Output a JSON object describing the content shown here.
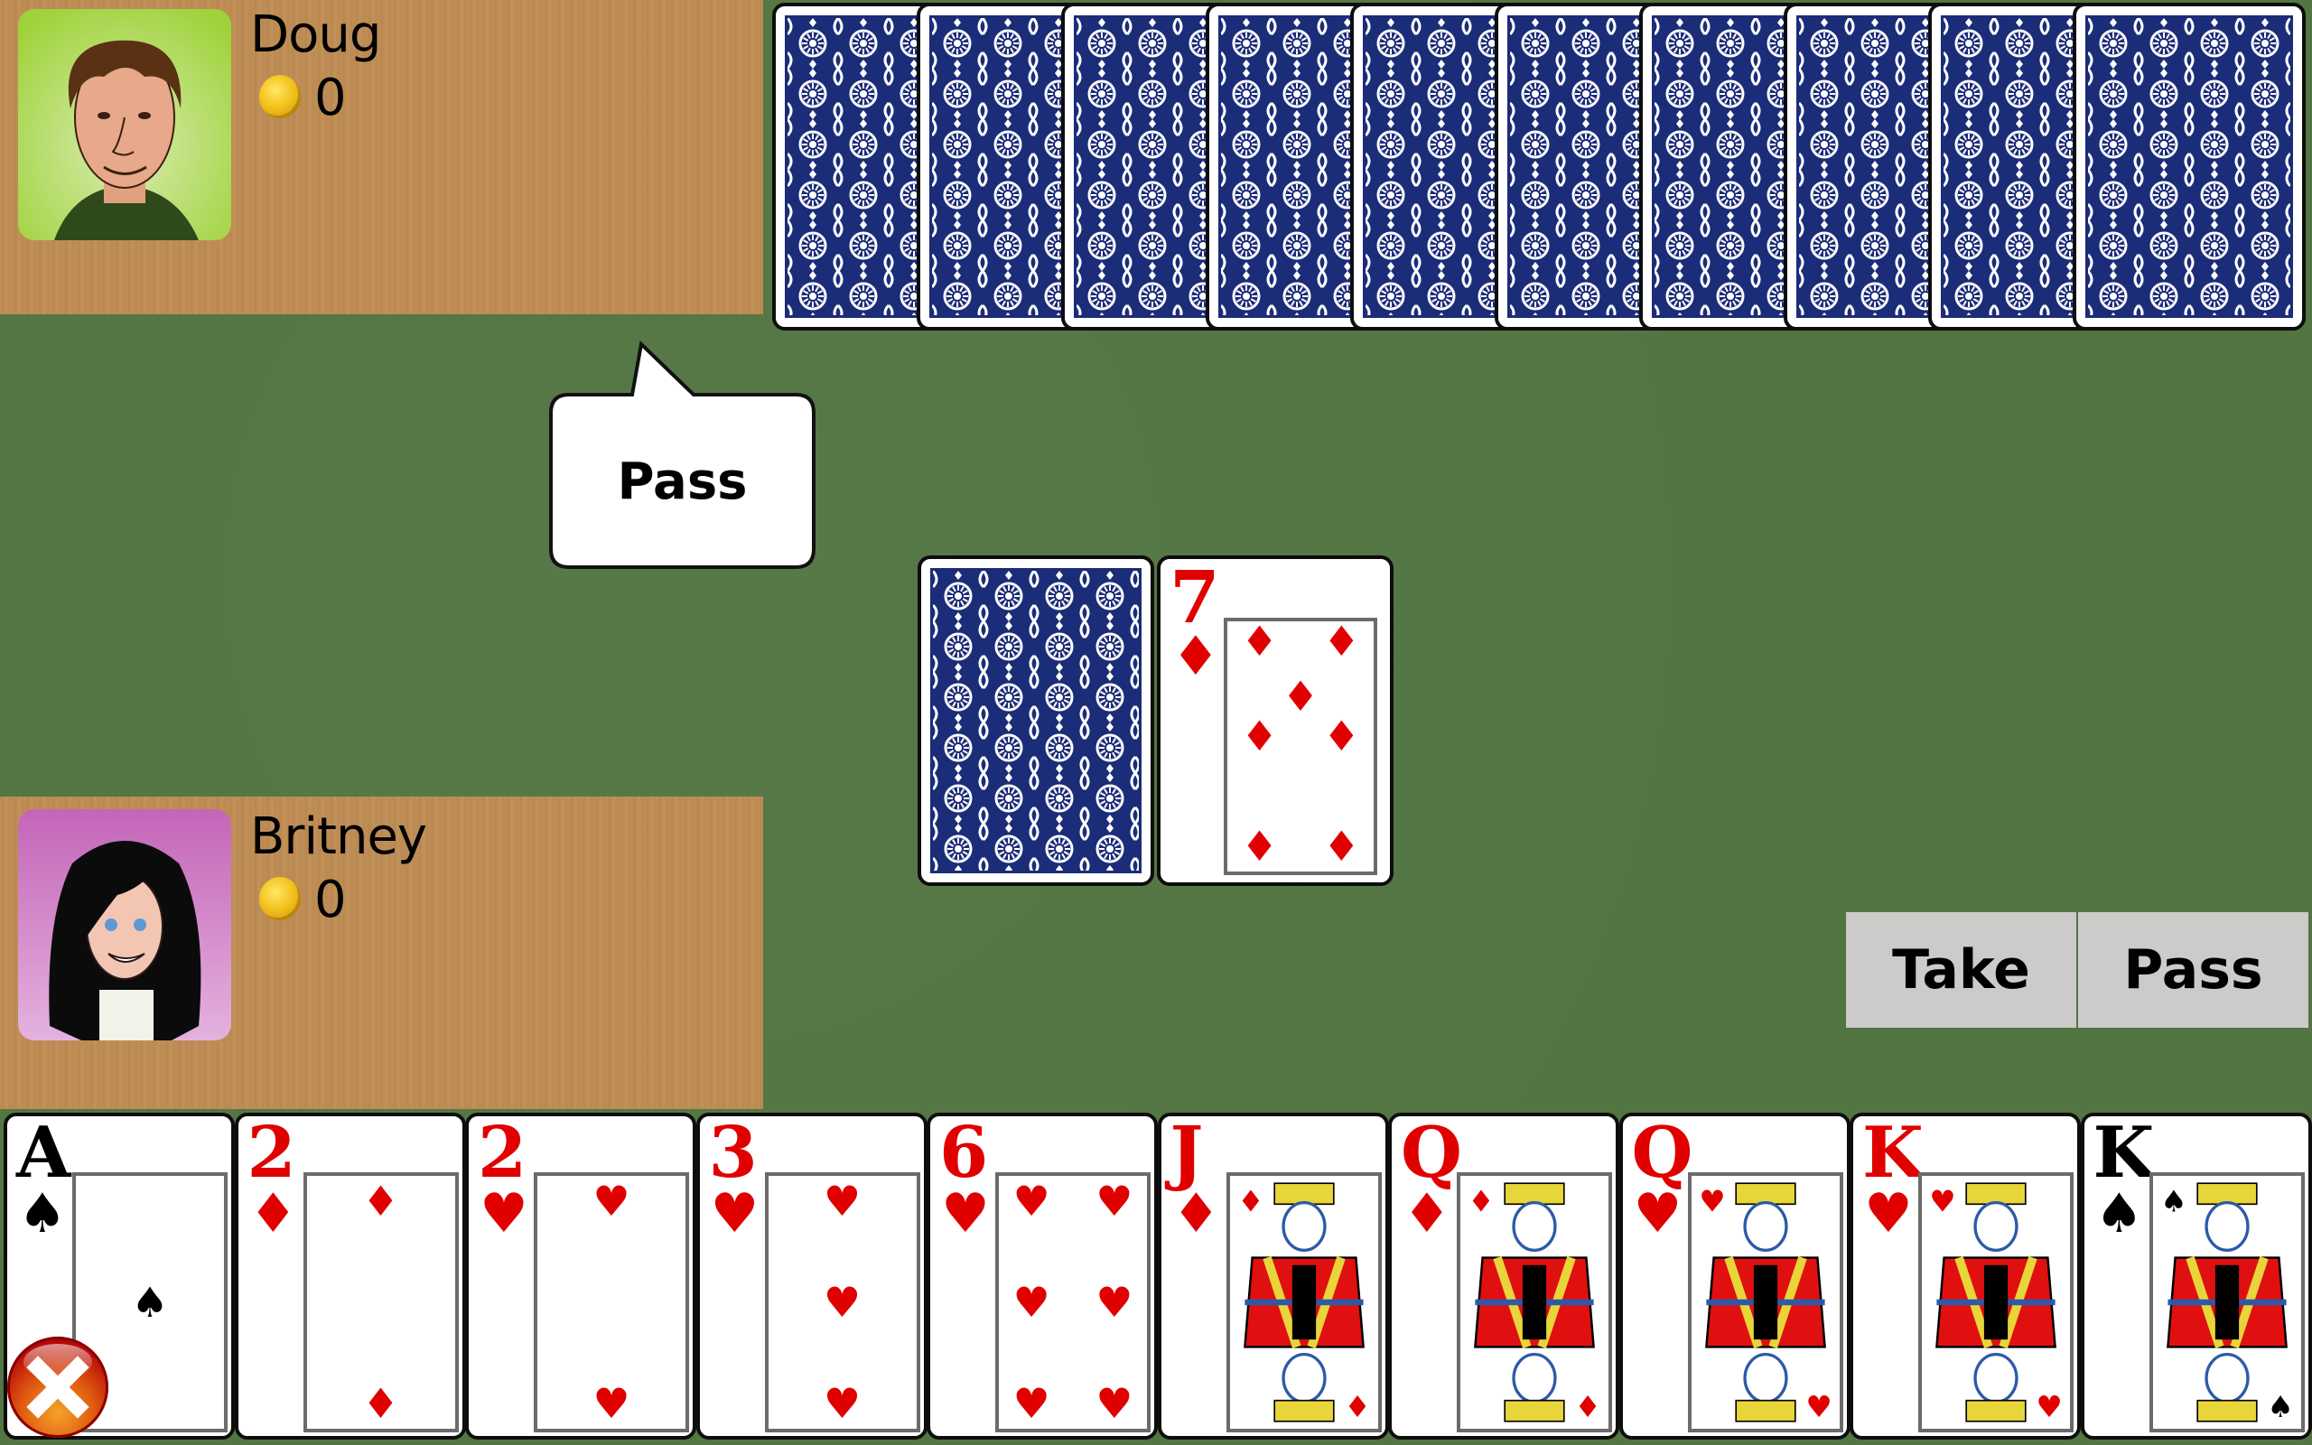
{
  "colors": {
    "felt": "#527542",
    "wood": "#bf8e57",
    "card_back": "#1b2c78",
    "red_suit": "#e00000",
    "button_bg": "#cdcaca"
  },
  "players": {
    "top": {
      "name": "Doug",
      "coins": "0",
      "avatar": "man-with-brown-hair-avatar",
      "speech": "Pass"
    },
    "bottom": {
      "name": "Britney",
      "coins": "0",
      "avatar": "woman-with-black-hair-avatar"
    }
  },
  "opponent_hand": {
    "count": 10,
    "face": "down"
  },
  "table": {
    "deck": {
      "face": "down"
    },
    "upcard": {
      "rank": "7",
      "suit": "diamonds",
      "symbol": "♦",
      "color": "red"
    }
  },
  "actions": {
    "take_label": "Take",
    "pass_label": "Pass"
  },
  "player_hand": [
    {
      "rank": "A",
      "suit": "spades",
      "symbol": "♠",
      "color": "black"
    },
    {
      "rank": "2",
      "suit": "diamonds",
      "symbol": "♦",
      "color": "red"
    },
    {
      "rank": "2",
      "suit": "hearts",
      "symbol": "♥",
      "color": "red"
    },
    {
      "rank": "3",
      "suit": "hearts",
      "symbol": "♥",
      "color": "red"
    },
    {
      "rank": "6",
      "suit": "hearts",
      "symbol": "♥",
      "color": "red"
    },
    {
      "rank": "J",
      "suit": "diamonds",
      "symbol": "♦",
      "color": "red"
    },
    {
      "rank": "Q",
      "suit": "diamonds",
      "symbol": "♦",
      "color": "red"
    },
    {
      "rank": "Q",
      "suit": "hearts",
      "symbol": "♥",
      "color": "red"
    },
    {
      "rank": "K",
      "suit": "hearts",
      "symbol": "♥",
      "color": "red"
    },
    {
      "rank": "K",
      "suit": "spades",
      "symbol": "♠",
      "color": "black"
    }
  ],
  "icons": {
    "exit": "close-icon",
    "coin": "coin-icon"
  }
}
